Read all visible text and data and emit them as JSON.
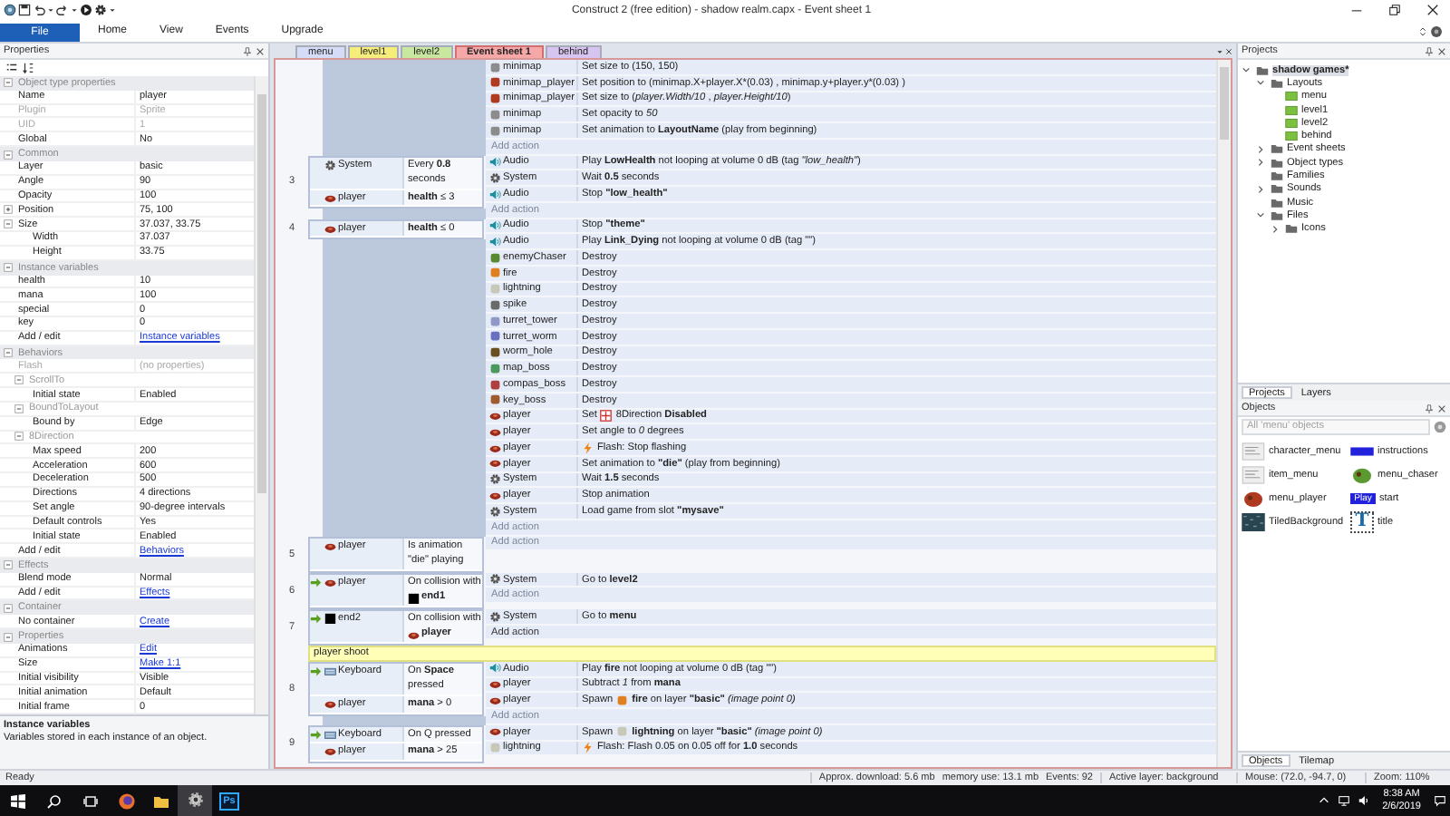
{
  "window": {
    "title": "Construct 2 (free edition) - shadow realm.capx - Event sheet 1"
  },
  "ribbon_tabs": [
    {
      "label": "File",
      "kind": "app"
    },
    {
      "label": "Home",
      "kind": "tab"
    },
    {
      "label": "View",
      "kind": "tab"
    },
    {
      "label": "Events",
      "kind": "tab"
    },
    {
      "label": "Upgrade",
      "kind": "tab"
    }
  ],
  "properties": {
    "title": "Properties",
    "sections": [
      {
        "title": "Object type properties",
        "expanded": true,
        "rows": [
          {
            "name": "Name",
            "value": "player",
            "kind": "value",
            "disabled": false
          },
          {
            "name": "Plugin",
            "value": "Sprite",
            "kind": "value",
            "disabled": true
          },
          {
            "name": "UID",
            "value": "1",
            "kind": "value",
            "disabled": true
          },
          {
            "name": "Global",
            "value": "No",
            "kind": "value",
            "disabled": false
          }
        ]
      },
      {
        "title": "Common",
        "expanded": true,
        "rows": [
          {
            "name": "Layer",
            "value": "basic",
            "kind": "value",
            "disabled": false
          },
          {
            "name": "Angle",
            "value": "90",
            "kind": "value",
            "disabled": false
          },
          {
            "name": "Opacity",
            "value": "100",
            "kind": "value",
            "disabled": false
          },
          {
            "name": "Position",
            "value": "75, 100",
            "kind": "value",
            "disabled": false,
            "expanded": false
          },
          {
            "name": "Size",
            "value": "37.037, 33.75",
            "kind": "value",
            "disabled": false,
            "expanded": true,
            "children": [
              {
                "name": "Width",
                "value": "37.037",
                "kind": "value",
                "disabled": false
              },
              {
                "name": "Height",
                "value": "33.75",
                "kind": "value",
                "disabled": false
              }
            ]
          }
        ]
      },
      {
        "title": "Instance variables",
        "expanded": true,
        "rows": [
          {
            "name": "health",
            "value": "10",
            "kind": "value",
            "disabled": false
          },
          {
            "name": "mana",
            "value": "100",
            "kind": "value",
            "disabled": false
          },
          {
            "name": "special",
            "value": "0",
            "kind": "value",
            "disabled": false
          },
          {
            "name": "key",
            "value": "0",
            "kind": "value",
            "disabled": false
          },
          {
            "name": "Add / edit",
            "value": "Instance variables",
            "kind": "link",
            "disabled": false
          }
        ]
      },
      {
        "title": "Behaviors",
        "expanded": true,
        "rows": [
          {
            "name": "Flash",
            "value": "(no properties)",
            "kind": "value",
            "disabled": true
          },
          {
            "name": "ScrollTo",
            "kind": "group",
            "expanded": true,
            "children": [
              {
                "name": "Initial state",
                "value": "Enabled",
                "kind": "value",
                "disabled": false
              }
            ]
          },
          {
            "name": "BoundToLayout",
            "kind": "group",
            "expanded": true,
            "children": [
              {
                "name": "Bound by",
                "value": "Edge",
                "kind": "value",
                "disabled": false
              }
            ]
          },
          {
            "name": "8Direction",
            "kind": "group",
            "expanded": true,
            "children": [
              {
                "name": "Max speed",
                "value": "200",
                "kind": "value",
                "disabled": false
              },
              {
                "name": "Acceleration",
                "value": "600",
                "kind": "value",
                "disabled": false
              },
              {
                "name": "Deceleration",
                "value": "500",
                "kind": "value",
                "disabled": false
              },
              {
                "name": "Directions",
                "value": "4 directions",
                "kind": "value",
                "disabled": false
              },
              {
                "name": "Set angle",
                "value": "90-degree intervals",
                "kind": "value",
                "disabled": false
              },
              {
                "name": "Default controls",
                "value": "Yes",
                "kind": "value",
                "disabled": false
              },
              {
                "name": "Initial state",
                "value": "Enabled",
                "kind": "value",
                "disabled": false
              }
            ]
          },
          {
            "name": "Add / edit",
            "value": "Behaviors",
            "kind": "link",
            "disabled": false
          }
        ]
      },
      {
        "title": "Effects",
        "expanded": true,
        "rows": [
          {
            "name": "Blend mode",
            "value": "Normal",
            "kind": "value",
            "disabled": false
          },
          {
            "name": "Add / edit",
            "value": "Effects",
            "kind": "link",
            "disabled": false
          }
        ]
      },
      {
        "title": "Container",
        "expanded": true,
        "rows": [
          {
            "name": "No container",
            "value": "Create",
            "kind": "link",
            "disabled": false
          }
        ]
      },
      {
        "title": "Properties",
        "expanded": true,
        "rows": [
          {
            "name": "Animations",
            "value": "Edit",
            "kind": "link",
            "disabled": false
          },
          {
            "name": "Size",
            "value": "Make 1:1",
            "kind": "link",
            "disabled": false
          },
          {
            "name": "Initial visibility",
            "value": "Visible",
            "kind": "value",
            "disabled": false
          },
          {
            "name": "Initial animation",
            "value": "Default",
            "kind": "value",
            "disabled": false
          },
          {
            "name": "Initial frame",
            "value": "0",
            "kind": "value",
            "disabled": false
          }
        ]
      }
    ],
    "description": {
      "title": "Instance variables",
      "text": "Variables stored in each instance of an object."
    }
  },
  "document_tabs": [
    {
      "label": "menu",
      "color": "#d4dcf8",
      "selected": false
    },
    {
      "label": "level1",
      "color": "#f6ee7a",
      "selected": false
    },
    {
      "label": "level2",
      "color": "#c8e8a0",
      "selected": false
    },
    {
      "label": "Event sheet 1",
      "color": "#f6a8a8",
      "selected": true
    },
    {
      "label": "behind",
      "color": "#d8c4f0",
      "selected": false
    }
  ],
  "event_sheet": {
    "items": [
      {
        "kind": "event",
        "actions": [
          {
            "object": "minimap",
            "kind": "sprite",
            "color": "#8c8c8c",
            "text": "Set size to (150, 150)"
          },
          {
            "object": "minimap_player",
            "kind": "sprite",
            "color": "#b03a20",
            "plain_text": "Set position to (minimap.X+player.X*(0.03) , minimap.y+player.y*(0.03) )"
          },
          {
            "object": "minimap_player",
            "kind": "sprite",
            "color": "#b03a20",
            "text": "Set size to (*player.Width/10* , *player.Height/10*)"
          },
          {
            "object": "minimap",
            "kind": "sprite",
            "color": "#8c8c8c",
            "text": "Set opacity to *50*"
          },
          {
            "object": "minimap",
            "kind": "sprite",
            "color": "#8c8c8c",
            "text": "Set animation to **LayoutName** (play from beginning)"
          }
        ],
        "add_action": {
          "label": "Add action",
          "hover": false
        }
      },
      {
        "kind": "event",
        "number": "3",
        "conditions": [
          {
            "object": "System",
            "kind": "system",
            "trigger": false,
            "text": "Every **0.8** seconds"
          },
          {
            "object": "player",
            "kind": "player",
            "trigger": false,
            "text": "**health** ≤ 3"
          }
        ],
        "actions": [
          {
            "object": "Audio",
            "kind": "audio",
            "text": "Play **LowHealth** not looping at volume 0 dB (tag *\"low_health\"*)"
          },
          {
            "object": "System",
            "kind": "system",
            "text": "Wait **0.5** seconds"
          },
          {
            "object": "Audio",
            "kind": "audio",
            "text": "Stop **\"low_health\"**"
          }
        ],
        "add_action": {
          "label": "Add action",
          "hover": false
        }
      },
      {
        "kind": "event",
        "number": "4",
        "conditions": [
          {
            "object": "player",
            "kind": "player",
            "trigger": false,
            "text": "**health** ≤ 0"
          }
        ],
        "actions": [
          {
            "object": "Audio",
            "kind": "audio",
            "text": "Stop **\"theme\"**"
          },
          {
            "object": "Audio",
            "kind": "audio",
            "text": "Play **Link_Dying** not looping at volume 0 dB (tag \"\")"
          },
          {
            "object": "enemyChaser",
            "kind": "sprite",
            "color": "#5a8a30",
            "text": "Destroy"
          },
          {
            "object": "fire",
            "kind": "sprite",
            "color": "#e08020",
            "text": "Destroy"
          },
          {
            "object": "lightning",
            "kind": "sprite",
            "color": "#c8c8b8",
            "text": "Destroy"
          },
          {
            "object": "spike",
            "kind": "sprite",
            "color": "#6a6a6a",
            "text": "Destroy"
          },
          {
            "object": "turret_tower",
            "kind": "sprite",
            "color": "#9098c8",
            "text": "Destroy"
          },
          {
            "object": "turret_worm",
            "kind": "sprite",
            "color": "#6a70c0",
            "text": "Destroy"
          },
          {
            "object": "worm_hole",
            "kind": "sprite",
            "color": "#6a5020",
            "text": "Destroy"
          },
          {
            "object": "map_boss",
            "kind": "sprite",
            "color": "#4a9a60",
            "text": "Destroy"
          },
          {
            "object": "compas_boss",
            "kind": "sprite",
            "color": "#b04040",
            "text": "Destroy"
          },
          {
            "object": "key_boss",
            "kind": "sprite",
            "color": "#a05a30",
            "text": "Destroy"
          },
          {
            "object": "player",
            "kind": "player",
            "pre": "Set",
            "inline": {
              "kind": "behavior"
            },
            "text": "8Direction **Disabled**"
          },
          {
            "object": "player",
            "kind": "player",
            "text": "Set angle to *0* degrees"
          },
          {
            "object": "player",
            "kind": "player",
            "inline": {
              "kind": "bolt"
            },
            "text": "Flash: Stop flashing"
          },
          {
            "object": "player",
            "kind": "player",
            "text": "Set animation to **\"die\"** (play from beginning)"
          },
          {
            "object": "System",
            "kind": "system",
            "text": "Wait **1.5** seconds"
          },
          {
            "object": "player",
            "kind": "player",
            "text": "Stop animation"
          },
          {
            "object": "System",
            "kind": "system",
            "text": "Load game from slot **\"mysave\"**"
          }
        ],
        "add_action": {
          "label": "Add action",
          "hover": false
        }
      },
      {
        "kind": "event",
        "number": "5",
        "conditions": [
          {
            "object": "player",
            "kind": "player",
            "trigger": false,
            "text": "Is animation \"die\" playing"
          }
        ],
        "add_action": {
          "label": "Add action",
          "hover": false
        }
      },
      {
        "kind": "event",
        "number": "6",
        "conditions": [
          {
            "object": "player",
            "kind": "player",
            "trigger": true,
            "text": "On collision with",
            "target": {
              "name": "end1",
              "kind": "square"
            }
          }
        ],
        "actions": [
          {
            "object": "System",
            "kind": "system",
            "text": "Go to **level2**"
          }
        ],
        "add_action": {
          "label": "Add action",
          "hover": false
        }
      },
      {
        "kind": "event",
        "number": "7",
        "conditions": [
          {
            "object": "end2",
            "kind": "square",
            "trigger": true,
            "text": "On collision with",
            "target": {
              "name": "player",
              "kind": "player"
            }
          }
        ],
        "actions": [
          {
            "object": "System",
            "kind": "system",
            "text": "Go to **menu**"
          }
        ],
        "add_action": {
          "label": "Add action",
          "hover": true
        }
      },
      {
        "kind": "comment",
        "text": "player shoot"
      },
      {
        "kind": "event",
        "number": "8",
        "conditions": [
          {
            "object": "Keyboard",
            "kind": "keyboard",
            "trigger": true,
            "text": "On **Space** pressed"
          },
          {
            "object": "player",
            "kind": "player",
            "trigger": false,
            "text": "**mana** > 0"
          }
        ],
        "actions": [
          {
            "object": "Audio",
            "kind": "audio",
            "text": "Play **fire** not looping at volume 0 dB (tag \"\")"
          },
          {
            "object": "player",
            "kind": "player",
            "text": "Subtract *1* from **mana**"
          },
          {
            "object": "player",
            "kind": "player",
            "pre": "Spawn",
            "inline": {
              "kind": "sprite",
              "color": "#e08020"
            },
            "text": "**fire** on layer **\"basic\"** *(image point 0)*"
          }
        ],
        "add_action": {
          "label": "Add action",
          "hover": false
        }
      },
      {
        "kind": "event",
        "number": "9",
        "conditions": [
          {
            "object": "Keyboard",
            "kind": "keyboard",
            "trigger": true,
            "text": "On Q pressed"
          },
          {
            "object": "player",
            "kind": "player",
            "trigger": false,
            "text": "**mana** > 25"
          }
        ],
        "actions": [
          {
            "object": "player",
            "kind": "player",
            "pre": "Spawn",
            "inline": {
              "kind": "sprite",
              "color": "#c8c8b8"
            },
            "text": "**lightning** on layer **\"basic\"** *(image point 0)*"
          },
          {
            "object": "lightning",
            "kind": "sprite",
            "color": "#c8c8b8",
            "inline": {
              "kind": "bolt"
            },
            "text": "Flash: Flash 0.05 on 0.05 off for **1.0** seconds"
          }
        ]
      }
    ]
  },
  "projects": {
    "title": "Projects",
    "tree": [
      {
        "label": "shadow games*",
        "kind": "project",
        "selected": true,
        "expanded": true,
        "children": [
          {
            "label": "Layouts",
            "kind": "folder",
            "selected": false,
            "expanded": true,
            "children": [
              {
                "label": "menu",
                "kind": "layout",
                "selected": false
              },
              {
                "label": "level1",
                "kind": "layout",
                "selected": false
              },
              {
                "label": "level2",
                "kind": "layout",
                "selected": false
              },
              {
                "label": "behind",
                "kind": "layout",
                "selected": false
              }
            ]
          },
          {
            "label": "Event sheets",
            "kind": "folder",
            "selected": false,
            "expanded": false
          },
          {
            "label": "Object types",
            "kind": "folder",
            "selected": false,
            "expanded": false
          },
          {
            "label": "Families",
            "kind": "folder",
            "selected": false
          },
          {
            "label": "Sounds",
            "kind": "folder",
            "selected": false,
            "expanded": false
          },
          {
            "label": "Music",
            "kind": "folder",
            "selected": false
          },
          {
            "label": "Files",
            "kind": "folder",
            "selected": false,
            "expanded": true,
            "children": [
              {
                "label": "Icons",
                "kind": "folder",
                "selected": false,
                "expanded": false
              }
            ]
          }
        ]
      }
    ],
    "tabs": [
      {
        "label": "Projects",
        "selected": true
      },
      {
        "label": "Layers",
        "selected": false
      }
    ]
  },
  "objects": {
    "title": "Objects",
    "filter_placeholder": "All 'menu' objects",
    "items": [
      {
        "name": "character_menu",
        "kind": "image"
      },
      {
        "name": "instructions",
        "kind": "bar"
      },
      {
        "name": "item_menu",
        "kind": "image"
      },
      {
        "name": "menu_chaser",
        "kind": "creature",
        "color": "#5a9a30"
      },
      {
        "name": "menu_player",
        "kind": "creature",
        "color": "#b03a20"
      },
      {
        "name": "start",
        "kind": "button",
        "thumb_text": "Play"
      },
      {
        "name": "TiledBackground",
        "kind": "tiled"
      },
      {
        "name": "title",
        "kind": "text",
        "thumb_text": "T"
      }
    ],
    "tabs": [
      {
        "label": "Objects",
        "selected": true
      },
      {
        "label": "Tilemap",
        "selected": false
      }
    ]
  },
  "status_bar": {
    "status": "Ready",
    "download": "Approx. download: 5.6 mb",
    "memory": "memory use: 13.1 mb",
    "events": "Events: 92",
    "layer": "Active layer: background",
    "mouse": "Mouse: (72.0, -94.7, 0)",
    "zoom": "Zoom: 110%"
  },
  "taskbar": {
    "apps": [
      {
        "kind": "firefox",
        "selected": false
      },
      {
        "kind": "folder",
        "selected": false
      },
      {
        "kind": "gear",
        "selected": true
      },
      {
        "kind": "photoshop",
        "label": "Ps",
        "selected": false
      }
    ],
    "time": "8:38 AM",
    "date": "2/6/2019"
  }
}
